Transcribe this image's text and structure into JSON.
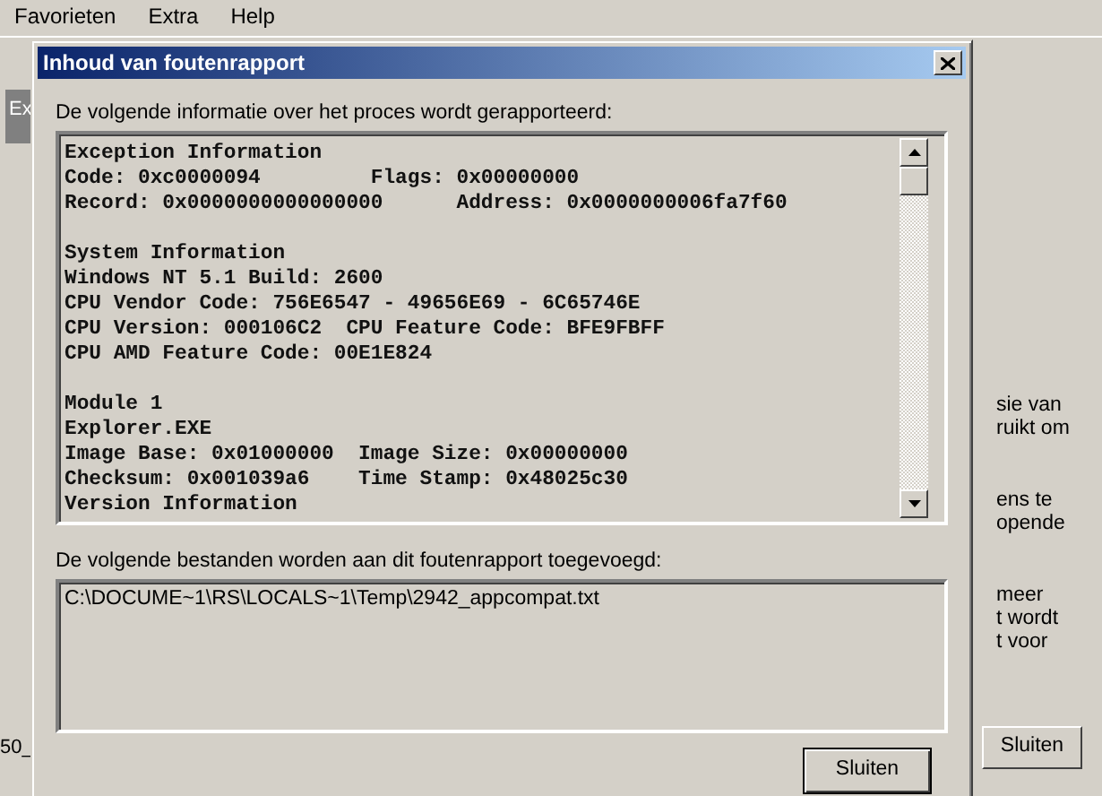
{
  "background_window": {
    "menu": [
      "Favorieten",
      "Extra",
      "Help"
    ],
    "left_tab": "Ex",
    "bottom_left_text": "50_",
    "side_text_groups": [
      [
        "sie van",
        "ruikt om"
      ],
      [
        "ens te",
        "opende"
      ],
      [
        "meer",
        "t wordt",
        "t voor"
      ]
    ],
    "close_button": "Sluiten"
  },
  "dialog": {
    "title": "Inhoud van foutenrapport",
    "info_label": "De volgende informatie over het proces wordt gerapporteerd:",
    "report_sections": [
      [
        "Exception Information",
        "Code: 0xc0000094         Flags: 0x00000000",
        "Record: 0x0000000000000000      Address: 0x0000000006fa7f60"
      ],
      [
        "System Information",
        "Windows NT 5.1 Build: 2600",
        "CPU Vendor Code: 756E6547 - 49656E69 - 6C65746E",
        "CPU Version: 000106C2  CPU Feature Code: BFE9FBFF",
        "CPU AMD Feature Code: 00E1E824"
      ],
      [
        "Module 1",
        "Explorer.EXE",
        "Image Base: 0x01000000  Image Size: 0x00000000",
        "Checksum: 0x001039a6    Time Stamp: 0x48025c30",
        "Version Information"
      ]
    ],
    "files_label": "De volgende bestanden worden aan dit foutenrapport toegevoegd:",
    "files": [
      "C:\\DOCUME~1\\RS\\LOCALS~1\\Temp\\2942_appcompat.txt"
    ],
    "close_button": "Sluiten"
  }
}
